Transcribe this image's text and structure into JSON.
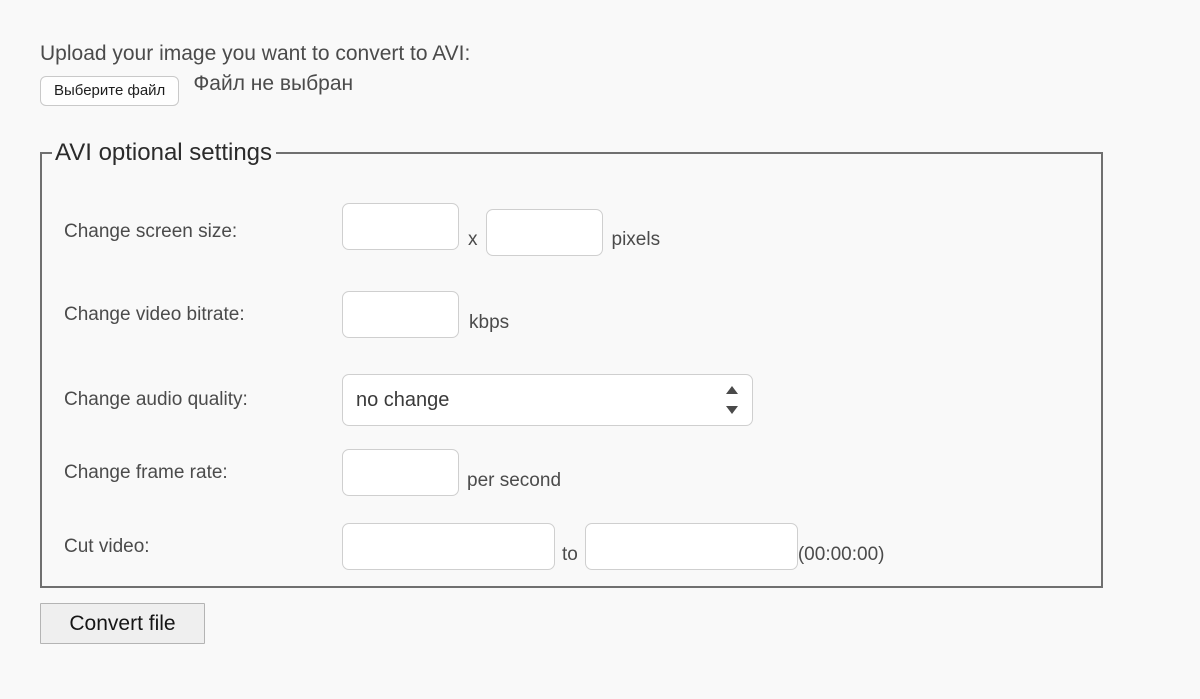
{
  "upload": {
    "heading": "Upload your image you want to convert to AVI:",
    "choose_file_label": "Выберите файл",
    "file_status": "Файл не выбран"
  },
  "settings": {
    "legend": "AVI optional settings",
    "rows": {
      "screen_size": {
        "label": "Change screen size:",
        "width_value": "",
        "width_placeholder": "",
        "separator": "x",
        "height_value": "",
        "height_placeholder": "",
        "unit": "pixels"
      },
      "video_bitrate": {
        "label": "Change video bitrate:",
        "value": "",
        "placeholder": "",
        "unit": "kbps"
      },
      "audio_quality": {
        "label": "Change audio quality:",
        "selected": "no change",
        "options": [
          "no change"
        ]
      },
      "frame_rate": {
        "label": "Change frame rate:",
        "value": "",
        "placeholder": "",
        "unit": "per second"
      },
      "cut_video": {
        "label": "Cut video:",
        "start_value": "",
        "start_placeholder": "",
        "separator": "to",
        "end_value": "",
        "end_placeholder": "",
        "format_hint": "(00:00:00)"
      }
    }
  },
  "actions": {
    "convert_label": "Convert file"
  },
  "colors": {
    "page_background": "#f9f9f9",
    "text": "#4b4b4b",
    "fieldset_border": "#707070",
    "input_border": "#cfcfcf",
    "button_face": "#efefef"
  }
}
